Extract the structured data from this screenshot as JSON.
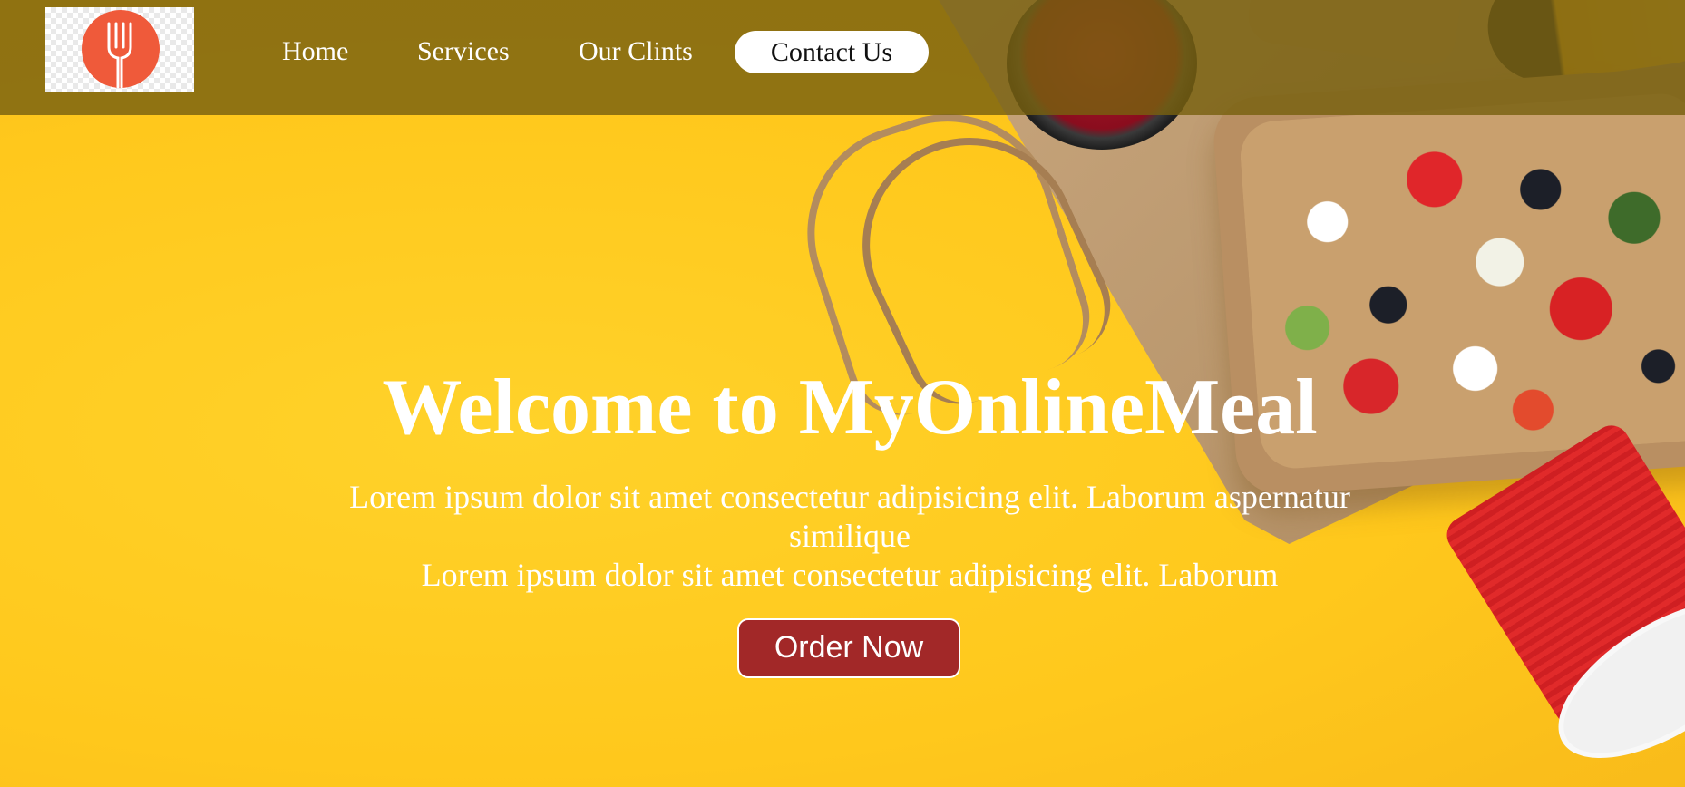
{
  "nav": {
    "logo_icon": "fork-icon",
    "links": [
      {
        "label": "Home"
      },
      {
        "label": "Services"
      },
      {
        "label": "Our Clints"
      }
    ],
    "contact_label": "Contact Us"
  },
  "hero": {
    "title": "Welcome to MyOnlineMeal",
    "text_line1": "Lorem ipsum dolor sit amet consectetur adipisicing elit. Laborum aspernatur",
    "text_line2": "similique",
    "text_line3": "Lorem ipsum dolor sit amet consectetur adipisicing elit. Laborum",
    "cta_label": "Order Now"
  },
  "colors": {
    "hero_bg": "#ffc81c",
    "navbar": "#786010",
    "cta": "#a22828",
    "logo_accent": "#ef5a3a"
  }
}
